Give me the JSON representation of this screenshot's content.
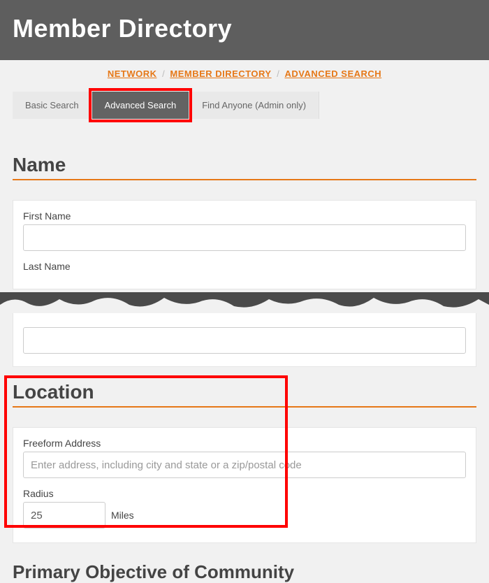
{
  "header": {
    "title": "Member Directory"
  },
  "breadcrumb": {
    "network": "NETWORK",
    "directory": "MEMBER DIRECTORY",
    "advanced": "ADVANCED SEARCH"
  },
  "tabs": {
    "basic": "Basic Search",
    "advanced": "Advanced Search",
    "admin": "Find Anyone (Admin only)"
  },
  "name_section": {
    "title": "Name",
    "first_label": "First Name",
    "last_label": "Last Name"
  },
  "location_section": {
    "title": "Location",
    "address_label": "Freeform Address",
    "address_placeholder": "Enter address, including city and state or a zip/postal code",
    "radius_label": "Radius",
    "radius_value": "25",
    "radius_unit": "Miles"
  },
  "objective_section": {
    "title": "Primary Objective of Community"
  }
}
